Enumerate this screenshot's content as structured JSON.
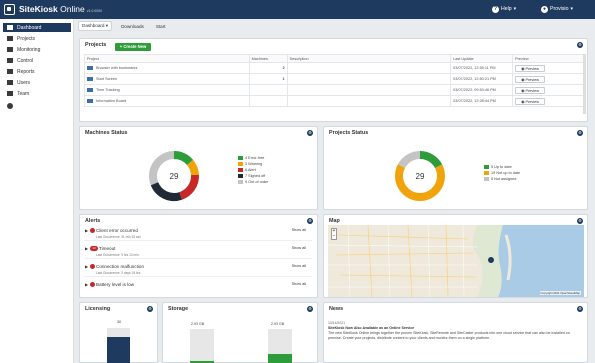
{
  "app": {
    "brand_bold": "SiteKiosk",
    "brand_light": " Online",
    "version": "v1.0.0000",
    "help_label": "Help",
    "user_label": "Provisio"
  },
  "sidebar": {
    "items": [
      {
        "label": "Dashboard",
        "icon": "dashboard-icon"
      },
      {
        "label": "Projects",
        "icon": "projects-icon"
      },
      {
        "label": "Monitoring",
        "icon": "monitoring-icon"
      },
      {
        "label": "Control",
        "icon": "control-icon"
      },
      {
        "label": "Reports",
        "icon": "reports-icon"
      },
      {
        "label": "Users",
        "icon": "users-icon"
      },
      {
        "label": "Team",
        "icon": "team-icon"
      }
    ]
  },
  "tabs": [
    {
      "label": "Dashboard",
      "active": true
    },
    {
      "label": "Downloads",
      "active": false
    },
    {
      "label": "Start",
      "active": false
    }
  ],
  "projects": {
    "title": "Projects",
    "create_label": "+  Create New",
    "columns": [
      "Project",
      "Machines",
      "Description",
      "Last Update",
      "Preview"
    ],
    "rows": [
      {
        "name": "Browser with bookmarks",
        "machines": "2",
        "description": "",
        "updated": "03/07/2022, 12:59:11 PM",
        "preview": "Preview"
      },
      {
        "name": "Start Screen",
        "machines": "1",
        "description": "",
        "updated": "03/07/2022, 12:50:21 PM",
        "preview": "Preview"
      },
      {
        "name": "Time Tracking",
        "machines": "",
        "description": "",
        "updated": "03/07/2022, 09:53:46 PM",
        "preview": "Preview"
      },
      {
        "name": "Information Board",
        "machines": "",
        "description": "",
        "updated": "03/07/2022, 12:28:44 PM",
        "preview": "Preview"
      }
    ]
  },
  "machines_status": {
    "title": "Machines Status",
    "total": "29",
    "legend": [
      {
        "label": "4 Error-free",
        "color": "#2e9c3a"
      },
      {
        "label": "3 Warning",
        "color": "#f0a30a"
      },
      {
        "label": "6 Alert",
        "color": "#c62828"
      },
      {
        "label": "7 Signed off",
        "color": "#1f2a36"
      },
      {
        "label": "9 Out of order",
        "color": "#c4c4c4"
      }
    ],
    "slices": [
      4,
      3,
      6,
      7,
      9
    ]
  },
  "projects_status": {
    "title": "Projects Status",
    "total": "29",
    "legend": [
      {
        "label": "5 Up to date",
        "color": "#2e9c3a"
      },
      {
        "label": "19 Not up to date",
        "color": "#f0a30a"
      },
      {
        "label": "5 Not assigned",
        "color": "#c4c4c4"
      }
    ],
    "slices": [
      5,
      19,
      5
    ]
  },
  "alerts": {
    "title": "Alerts",
    "show_all": "Show all",
    "items": [
      {
        "title": "Client error occurred",
        "sub": "Last Occurrence: 31 min 53 sec",
        "badge": "!"
      },
      {
        "title": "Timeout",
        "sub": "Last Occurrence: 9 hrs 13 min",
        "badge": "13"
      },
      {
        "title": "Connection malfunction",
        "sub": "Last Occurrence: 3 days 18 hrs",
        "badge": "!"
      },
      {
        "title": "Battery level is low",
        "sub": "",
        "badge": "!"
      }
    ]
  },
  "map": {
    "title": "Map",
    "attribution": "Copyright 2021 OpenStreetMap"
  },
  "licensing": {
    "title": "Licensing",
    "value": "30",
    "fill": 0.75
  },
  "storage": {
    "title": "Storage",
    "bars": [
      {
        "label": "2.93 GB",
        "fill": 0.08
      },
      {
        "label": "2.93 GB",
        "fill": 0.3
      }
    ]
  },
  "news": {
    "title": "News",
    "date": "10/14/2021",
    "headline": "SiteKiosk Now Also Available as an Online Service",
    "body": "The new SiteKiosk Online brings together the proven SiteKiosk, SiteRemote and SiteCaster products into one cloud service that can also be installed on premise. Create your projects, distribute content to your clients and monitor them on a single platform."
  },
  "colors": {
    "navy": "#1f3a5f",
    "green": "#2e9c3a",
    "orange": "#f0a30a",
    "red": "#c62828"
  }
}
